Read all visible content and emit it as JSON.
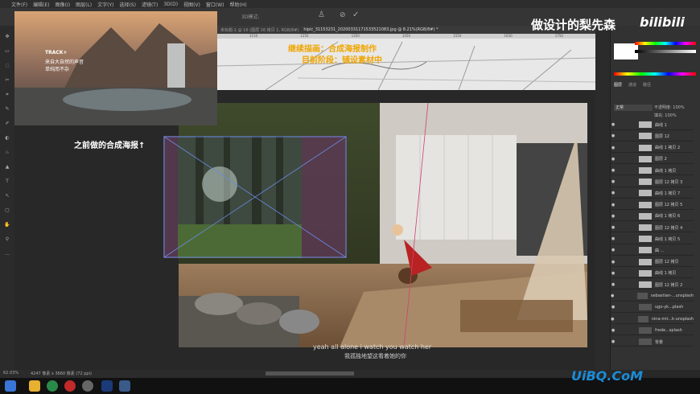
{
  "menubar": {
    "items": [
      "文件(F)",
      "编辑(E)",
      "图像(I)",
      "图层(L)",
      "文字(Y)",
      "选择(S)",
      "滤镜(T)",
      "3D(D)",
      "视图(V)",
      "窗口(W)",
      "帮助(H)"
    ]
  },
  "optionsbar": {
    "mode_label": "3D模式:"
  },
  "tabs": [
    "未标题-1 @ 16 (图层 16 拷贝 1, RGB/8#)",
    "hipic_31153231_20200331171533521083.jpg @ 8.21%(RGB/8#) *"
  ],
  "ruler": [
    "1150",
    "1200",
    "1250",
    "1300",
    "1350",
    "1400",
    "1450",
    "1500",
    "1550",
    "1600",
    "1650",
    "1700",
    "1750",
    "1800"
  ],
  "watermark": {
    "channel": "做设计的梨先森",
    "site": "bilibili"
  },
  "thumb": {
    "brand": "TRACK+",
    "line1": "来自大自然的声音",
    "line2": "单纯而不杂"
  },
  "sketch_note": {
    "line1": "继续描画：合成海报制作",
    "line2": "目前阶段：铺设素材中"
  },
  "annotation": "之前做的合成海报↑",
  "subtitle": {
    "en": "yeah all alone i watch you watch her",
    "zh": "我孤独地望这看着她的你"
  },
  "panels": {
    "tabs": [
      "图层",
      "通道",
      "路径"
    ],
    "blend_mode": "正常",
    "opacity_label": "不透明度: 100%",
    "fill_label": "填充: 100%"
  },
  "layers": [
    "曲线 1",
    "图层 12",
    "曲线 1 拷贝 2",
    "图层 2",
    "曲线 1 拷贝",
    "图层 12 拷贝 3",
    "曲线 1 拷贝 7",
    "图层 12 拷贝 5",
    "曲线 1 拷贝 6",
    "图层 12 拷贝 4",
    "曲线 1 拷贝 5",
    "曲 ...",
    "图层 12 拷贝",
    "曲线 1 拷贝",
    "图层 12 拷贝 2",
    "sebastian-...unsplash",
    "ugo-yk...plash",
    "nina-mir...k-unsplash",
    "frede...splash",
    "背景"
  ],
  "status": {
    "zoom": "62.03%",
    "doc": "4247 像素 x 3660 像素 (72 ppi)"
  },
  "corner_logo": "UiBQ.CoM"
}
